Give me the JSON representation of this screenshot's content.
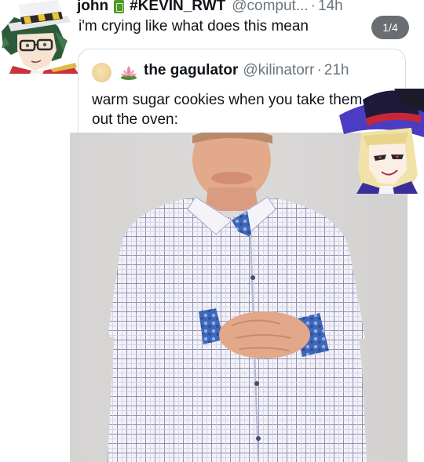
{
  "tweet": {
    "author_name": "john",
    "author_tag": "#KEVIN_RWT",
    "handle": "@comput...",
    "separator": "·",
    "time": "14h",
    "more_label": "···",
    "text": "i'm crying like what does this mean",
    "page_indicator": "1/4"
  },
  "quoted_tweet": {
    "author_name": "the gagulator",
    "handle": "@kilinatorr",
    "separator": "·",
    "time": "21h",
    "text": "warm sugar cookies when you take them out the oven:",
    "emoji_icon": "lotus-icon"
  },
  "colors": {
    "text_primary": "#0f1419",
    "text_secondary": "#6b7680",
    "pill_background": "#6a6e72",
    "card_border": "#d7dde2"
  }
}
